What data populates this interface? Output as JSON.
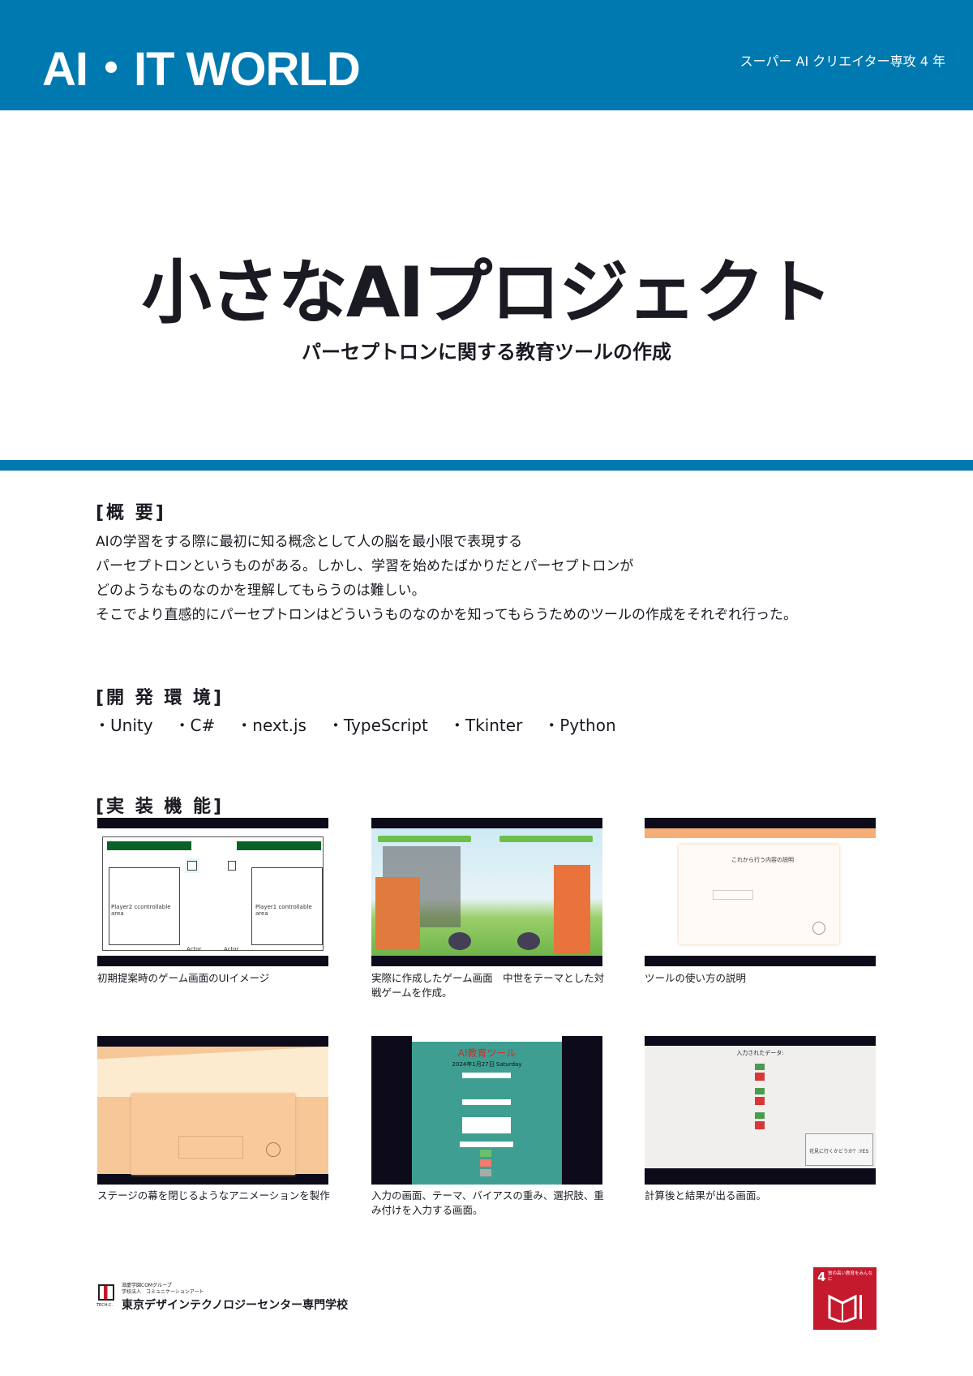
{
  "header": {
    "brand": "AI・IT WORLD",
    "department": "スーパー AI クリエイター専攻 4 年"
  },
  "title": "小さなAIプロジェクト",
  "subtitle": "パーセプトロンに関する教育ツールの作成",
  "overview": {
    "heading": "[概 要]",
    "lines": [
      "AIの学習をする際に最初に知る概念として人の脳を最小限で表現する",
      "パーセプトロンというものがある。しかし、学習を始めたばかりだとパーセプトロンが",
      "どのようなものなのかを理解してもらうのは難しい。",
      "そこでより直感的にパーセプトロンはどういうものなのかを知ってもらうためのツールの作成をそれぞれ行った。"
    ]
  },
  "environment": {
    "heading": "[開 発 環 境]",
    "items": [
      "・Unity",
      "・C#",
      "・next.js",
      "・TypeScript",
      "・Tkinter",
      "・Python"
    ]
  },
  "features": {
    "heading": "[実 装 機 能]",
    "items": [
      {
        "caption": "初期提案時のゲーム画面のUIイメージ",
        "labels": [
          "Player2 ccontrollable area",
          "Player1 controllable area",
          "Actor",
          "Actor"
        ]
      },
      {
        "caption": "実際に作成したゲーム画面　中世をテーマとした対戦ゲームを作成。"
      },
      {
        "caption": "ツールの使い方の説明",
        "labels": [
          "これから行う内容の説明"
        ]
      },
      {
        "caption": "ステージの幕を閉じるようなアニメーションを製作"
      },
      {
        "caption": "入力の画面、テーマ、バイアスの重み、選択肢、重み付けを入力する画面。",
        "labels": [
          "AI教育ツール",
          "2024年1月27日 Saturday"
        ]
      },
      {
        "caption": "計算後と結果が出る画面。",
        "labels": [
          "入力されたデータ:",
          "花見に行くかどうか？:YES"
        ]
      }
    ]
  },
  "footer": {
    "group": "滋慶学園COMグループ",
    "corp": "学校法人　コミュニケーションアート",
    "school": "東京デザインテクノロジーセンター専門学校",
    "logo_text": "TECH.C.",
    "sdg_number": "4",
    "sdg_label": "質の高い教育をみんなに"
  },
  "colors": {
    "brand_blue": "#0079b0",
    "sdg_red": "#c5192d"
  }
}
